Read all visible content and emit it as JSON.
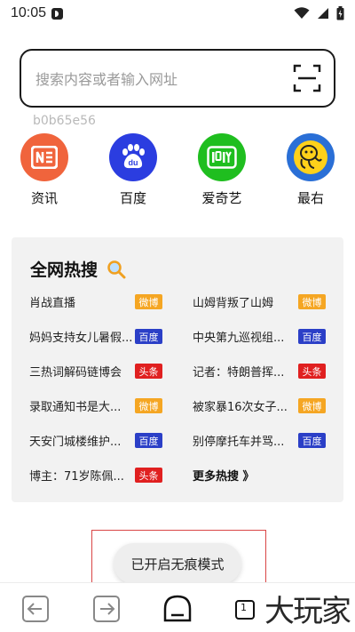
{
  "status_bar": {
    "time": "10:05",
    "icons": [
      "d-app-icon",
      "wifi-icon",
      "cell-signal-icon",
      "battery-icon"
    ]
  },
  "search": {
    "placeholder": "搜索内容或者输入网址",
    "scan_icon": "scan-icon"
  },
  "hash_label": "b0b65e56",
  "quick_links": [
    {
      "label": "资讯",
      "icon": "news-icon",
      "color": "#f0643c"
    },
    {
      "label": "百度",
      "icon": "baidu-paw-icon",
      "color": "#2b3de0"
    },
    {
      "label": "爱奇艺",
      "icon": "iqiyi-icon",
      "color": "#1fbe1f"
    },
    {
      "label": "最右",
      "icon": "zuiyou-icon",
      "color": "#ffd11a"
    }
  ],
  "hot": {
    "title": "全网热搜",
    "rows": [
      [
        {
          "text": "肖战直播",
          "badge": "微博",
          "color": "#f5a623"
        },
        {
          "text": "山姆背叛了山姆",
          "badge": "微博",
          "color": "#f5a623"
        }
      ],
      [
        {
          "text": "妈妈支持女儿暑假...",
          "badge": "百度",
          "color": "#2b3fc7"
        },
        {
          "text": "中央第九巡视组...",
          "badge": "百度",
          "color": "#2b3fc7"
        }
      ],
      [
        {
          "text": "三热词解码链博会",
          "badge": "头条",
          "color": "#e02020"
        },
        {
          "text": "记者：特朗普挥...",
          "badge": "头条",
          "color": "#e02020"
        }
      ],
      [
        {
          "text": "录取通知书是大...",
          "badge": "微博",
          "color": "#f5a623"
        },
        {
          "text": "被家暴16次女子...",
          "badge": "微博",
          "color": "#f5a623"
        }
      ],
      [
        {
          "text": "天安门城楼维护...",
          "badge": "百度",
          "color": "#2b3fc7"
        },
        {
          "text": "别停摩托车并骂...",
          "badge": "百度",
          "color": "#2b3fc7"
        }
      ]
    ],
    "last_left": {
      "text": "博主：71岁陈佩...",
      "badge": "头条",
      "color": "#e02020"
    },
    "more": "更多热搜 》"
  },
  "toast": "已开启无痕模式",
  "bottom_nav": {
    "tab_count": "1",
    "watermark": "大玩家"
  }
}
